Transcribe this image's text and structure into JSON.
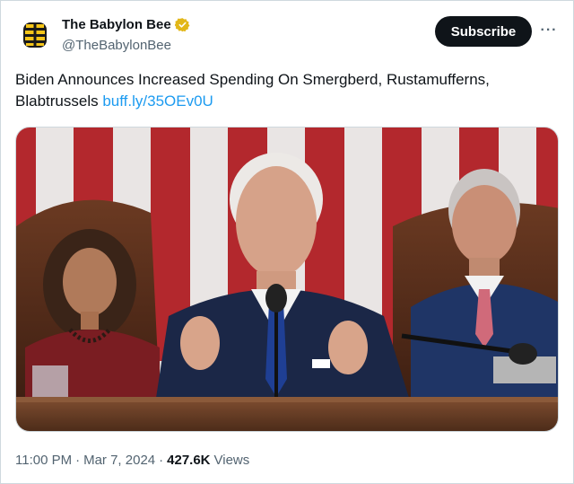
{
  "account": {
    "display_name": "The Babylon Bee",
    "handle": "@TheBabylonBee",
    "verified_badge": "gold-verified-badge-icon",
    "avatar": "bee-logo-icon"
  },
  "actions": {
    "subscribe_label": "Subscribe",
    "more_label": "···"
  },
  "tweet": {
    "text": "Biden Announces Increased Spending On Smergberd, Rustamufferns, Blabtrussels",
    "link": "buff.ly/35OEv0U"
  },
  "meta": {
    "time": "11:00 PM",
    "separator": "·",
    "date": "Mar 7, 2024",
    "views_count": "427.6K",
    "views_label": "Views"
  },
  "colors": {
    "link": "#1d9bf0",
    "verified": "#e2b719",
    "subscribe_bg": "#0f1419",
    "muted": "#536471"
  }
}
